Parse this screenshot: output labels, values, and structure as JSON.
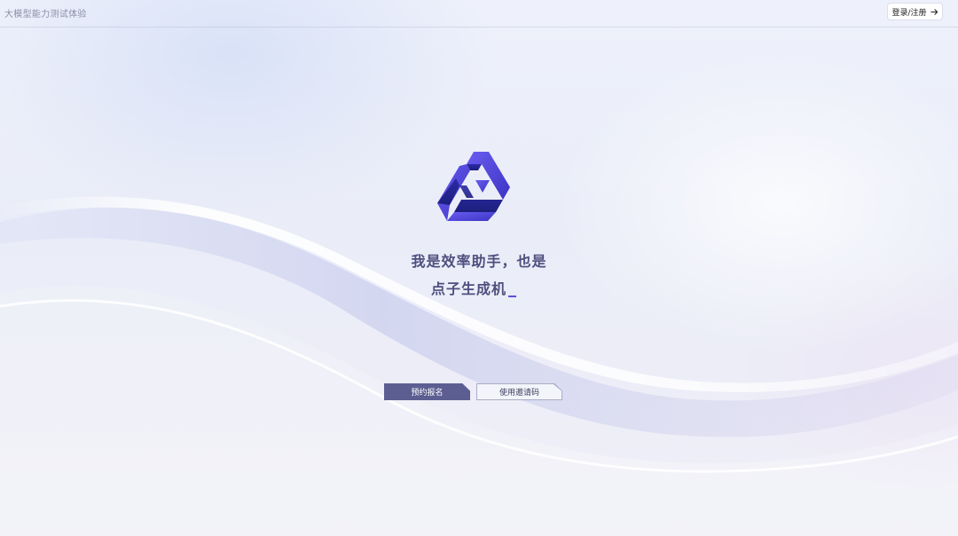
{
  "header": {
    "site_title": "大模型能力测试体验",
    "login_label": "登录/注册"
  },
  "hero": {
    "headline_line1": "我是效率助手，也是",
    "headline_line2": "点子生成机"
  },
  "actions": {
    "primary_label": "预约报名",
    "secondary_label": "使用邀请码"
  },
  "colors": {
    "logo_primary": "#4f3fd6",
    "logo_secondary": "#2a2aa8",
    "headline_text": "#4e4f7e",
    "primary_button": "#5c5e92",
    "cursor": "#5a52e0"
  },
  "icons": {
    "logo": "app-logo-icon",
    "login_arrow": "arrow-right-icon"
  }
}
